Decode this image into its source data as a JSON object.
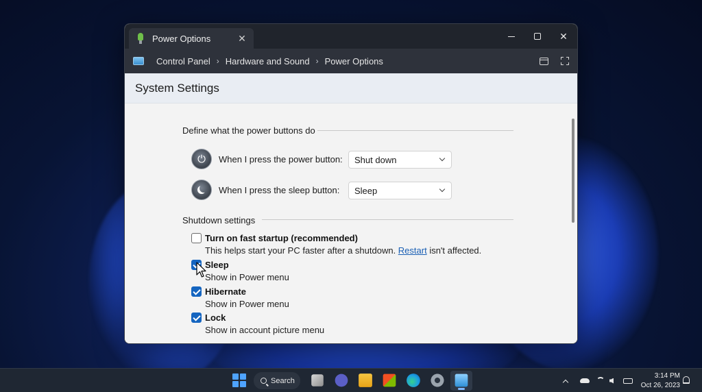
{
  "window": {
    "tab_title": "Power Options",
    "tab_close": "✕",
    "minimize": "",
    "maximize": "",
    "close": "✕"
  },
  "breadcrumb": {
    "items": [
      "Control Panel",
      "Hardware and Sound",
      "Power Options"
    ],
    "separator": "›"
  },
  "page": {
    "title": "System Settings"
  },
  "power_buttons": {
    "heading": "Define what the power buttons do",
    "power": {
      "label": "When I press the power button:",
      "value": "Shut down",
      "icon": "power-icon"
    },
    "sleep": {
      "label": "When I press the sleep button:",
      "value": "Sleep",
      "icon": "sleep-moon-icon"
    }
  },
  "shutdown": {
    "heading": "Shutdown settings",
    "fast_startup": {
      "title": "Turn on fast startup (recommended)",
      "checked": false,
      "desc_before": "This helps start your PC faster after a shutdown. ",
      "desc_link": "Restart",
      "desc_after": " isn't affected."
    },
    "items": [
      {
        "title": "Sleep",
        "desc": "Show in Power menu",
        "checked": true
      },
      {
        "title": "Hibernate",
        "desc": "Show in Power menu",
        "checked": true
      },
      {
        "title": "Lock",
        "desc": "Show in account picture menu",
        "checked": true
      }
    ]
  },
  "taskbar": {
    "search_label": "Search",
    "apps": [
      "start-icon",
      "task-view-icon",
      "meet-icon",
      "file-explorer-icon",
      "store-icon",
      "edge-icon",
      "settings-icon",
      "control-panel-icon"
    ],
    "time": "3:14 PM",
    "date": "Oct 26, 2023"
  },
  "colors": {
    "accent": "#1565c0",
    "link": "#1a5fb4",
    "titlebar": "#20242c"
  }
}
